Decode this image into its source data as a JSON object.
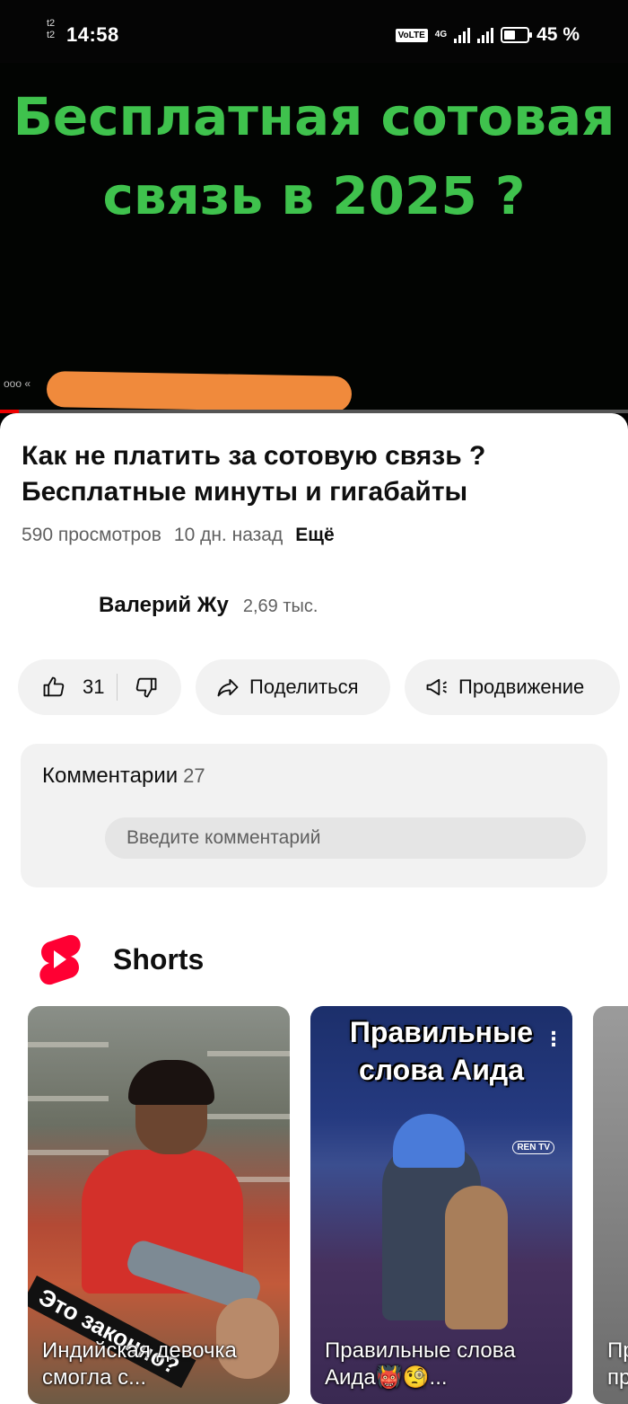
{
  "status_bar": {
    "carrier_1": "t2",
    "carrier_2": "t2",
    "time": "14:58",
    "volte": "VoLTE",
    "network": "4G",
    "battery": "45 %"
  },
  "video": {
    "overlay_text_line1": "Бесплатная сотовая",
    "overlay_text_line2": "связь в 2025 ?",
    "channel_watermark": "ооо «",
    "overlay_color": "#3fc24d",
    "progress_percent": 3
  },
  "info": {
    "title": "Как не платить за сотовую связь ? Бесплатные минуты и гигабайты",
    "views": "590 просмотров",
    "age": "10 дн. назад",
    "more": "Ещё"
  },
  "channel": {
    "name": "Валерий Жу",
    "subscribers": "2,69 тыс."
  },
  "actions": {
    "like_count": "31",
    "share_label": "Поделиться",
    "promote_label": "Продвижение"
  },
  "comments": {
    "label": "Комментарии",
    "count": "27",
    "placeholder": "Введите комментарий"
  },
  "shorts": {
    "section_title": "Shorts",
    "brand_color": "#ff0033",
    "items": [
      {
        "caption": "Индийская девочка смогла с...",
        "sticker": "Это законно?"
      },
      {
        "caption": "Правильные слова Аида👹🧐...",
        "overlay_title": "Правильные слова Аида",
        "tv_logo": "REN TV"
      },
      {
        "caption": "Пр\nпр"
      }
    ]
  }
}
